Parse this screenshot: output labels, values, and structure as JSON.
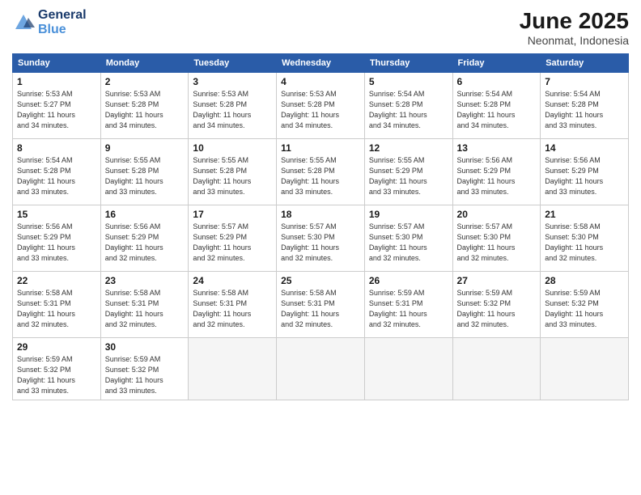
{
  "logo": {
    "line1": "General",
    "line2": "Blue"
  },
  "title": "June 2025",
  "location": "Neonmat, Indonesia",
  "days_of_week": [
    "Sunday",
    "Monday",
    "Tuesday",
    "Wednesday",
    "Thursday",
    "Friday",
    "Saturday"
  ],
  "weeks": [
    [
      {
        "day": "1",
        "info": "Sunrise: 5:53 AM\nSunset: 5:27 PM\nDaylight: 11 hours\nand 34 minutes."
      },
      {
        "day": "2",
        "info": "Sunrise: 5:53 AM\nSunset: 5:28 PM\nDaylight: 11 hours\nand 34 minutes."
      },
      {
        "day": "3",
        "info": "Sunrise: 5:53 AM\nSunset: 5:28 PM\nDaylight: 11 hours\nand 34 minutes."
      },
      {
        "day": "4",
        "info": "Sunrise: 5:53 AM\nSunset: 5:28 PM\nDaylight: 11 hours\nand 34 minutes."
      },
      {
        "day": "5",
        "info": "Sunrise: 5:54 AM\nSunset: 5:28 PM\nDaylight: 11 hours\nand 34 minutes."
      },
      {
        "day": "6",
        "info": "Sunrise: 5:54 AM\nSunset: 5:28 PM\nDaylight: 11 hours\nand 34 minutes."
      },
      {
        "day": "7",
        "info": "Sunrise: 5:54 AM\nSunset: 5:28 PM\nDaylight: 11 hours\nand 33 minutes."
      }
    ],
    [
      {
        "day": "8",
        "info": "Sunrise: 5:54 AM\nSunset: 5:28 PM\nDaylight: 11 hours\nand 33 minutes."
      },
      {
        "day": "9",
        "info": "Sunrise: 5:55 AM\nSunset: 5:28 PM\nDaylight: 11 hours\nand 33 minutes."
      },
      {
        "day": "10",
        "info": "Sunrise: 5:55 AM\nSunset: 5:28 PM\nDaylight: 11 hours\nand 33 minutes."
      },
      {
        "day": "11",
        "info": "Sunrise: 5:55 AM\nSunset: 5:28 PM\nDaylight: 11 hours\nand 33 minutes."
      },
      {
        "day": "12",
        "info": "Sunrise: 5:55 AM\nSunset: 5:29 PM\nDaylight: 11 hours\nand 33 minutes."
      },
      {
        "day": "13",
        "info": "Sunrise: 5:56 AM\nSunset: 5:29 PM\nDaylight: 11 hours\nand 33 minutes."
      },
      {
        "day": "14",
        "info": "Sunrise: 5:56 AM\nSunset: 5:29 PM\nDaylight: 11 hours\nand 33 minutes."
      }
    ],
    [
      {
        "day": "15",
        "info": "Sunrise: 5:56 AM\nSunset: 5:29 PM\nDaylight: 11 hours\nand 33 minutes."
      },
      {
        "day": "16",
        "info": "Sunrise: 5:56 AM\nSunset: 5:29 PM\nDaylight: 11 hours\nand 32 minutes."
      },
      {
        "day": "17",
        "info": "Sunrise: 5:57 AM\nSunset: 5:29 PM\nDaylight: 11 hours\nand 32 minutes."
      },
      {
        "day": "18",
        "info": "Sunrise: 5:57 AM\nSunset: 5:30 PM\nDaylight: 11 hours\nand 32 minutes."
      },
      {
        "day": "19",
        "info": "Sunrise: 5:57 AM\nSunset: 5:30 PM\nDaylight: 11 hours\nand 32 minutes."
      },
      {
        "day": "20",
        "info": "Sunrise: 5:57 AM\nSunset: 5:30 PM\nDaylight: 11 hours\nand 32 minutes."
      },
      {
        "day": "21",
        "info": "Sunrise: 5:58 AM\nSunset: 5:30 PM\nDaylight: 11 hours\nand 32 minutes."
      }
    ],
    [
      {
        "day": "22",
        "info": "Sunrise: 5:58 AM\nSunset: 5:31 PM\nDaylight: 11 hours\nand 32 minutes."
      },
      {
        "day": "23",
        "info": "Sunrise: 5:58 AM\nSunset: 5:31 PM\nDaylight: 11 hours\nand 32 minutes."
      },
      {
        "day": "24",
        "info": "Sunrise: 5:58 AM\nSunset: 5:31 PM\nDaylight: 11 hours\nand 32 minutes."
      },
      {
        "day": "25",
        "info": "Sunrise: 5:58 AM\nSunset: 5:31 PM\nDaylight: 11 hours\nand 32 minutes."
      },
      {
        "day": "26",
        "info": "Sunrise: 5:59 AM\nSunset: 5:31 PM\nDaylight: 11 hours\nand 32 minutes."
      },
      {
        "day": "27",
        "info": "Sunrise: 5:59 AM\nSunset: 5:32 PM\nDaylight: 11 hours\nand 32 minutes."
      },
      {
        "day": "28",
        "info": "Sunrise: 5:59 AM\nSunset: 5:32 PM\nDaylight: 11 hours\nand 33 minutes."
      }
    ],
    [
      {
        "day": "29",
        "info": "Sunrise: 5:59 AM\nSunset: 5:32 PM\nDaylight: 11 hours\nand 33 minutes."
      },
      {
        "day": "30",
        "info": "Sunrise: 5:59 AM\nSunset: 5:32 PM\nDaylight: 11 hours\nand 33 minutes."
      },
      {
        "day": "",
        "info": ""
      },
      {
        "day": "",
        "info": ""
      },
      {
        "day": "",
        "info": ""
      },
      {
        "day": "",
        "info": ""
      },
      {
        "day": "",
        "info": ""
      }
    ]
  ]
}
